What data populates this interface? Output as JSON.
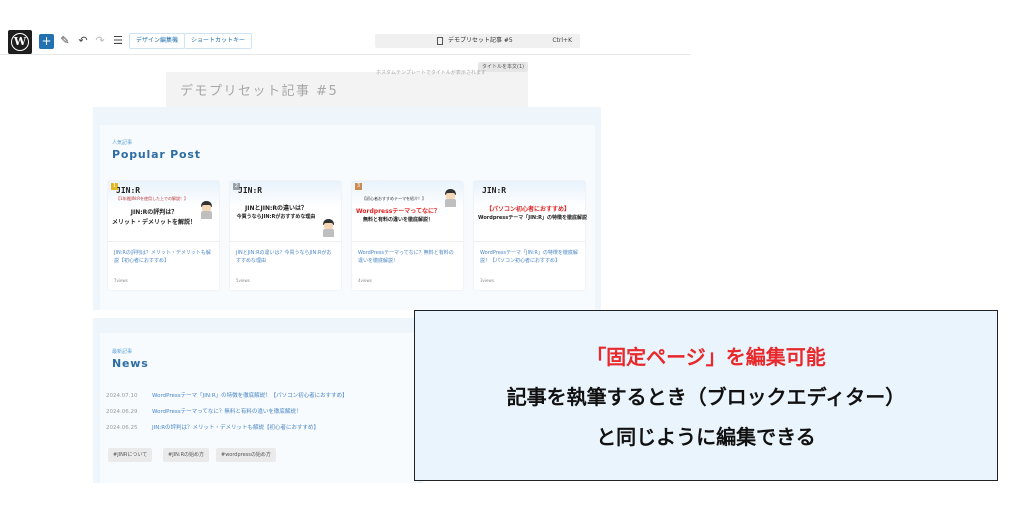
{
  "toolbar": {
    "design_edit_label": "デザイン編集機",
    "shortcut_label": "ショートカットキー",
    "document_title": "デモプリセット記事 #5",
    "shortcut_kbd": "Ctrl+K",
    "tooltip": "タイトルを本文(1)",
    "hint": "ホスタムテンプレートでタイトルが表示されます"
  },
  "editor": {
    "page_title": "デモプリセット記事 #5"
  },
  "popular": {
    "sub": "人気記事",
    "heading": "Popular Post",
    "cards": [
      {
        "rank": "1",
        "logo": "JIN:R",
        "caption": "【1年間JIN:Rを使用した上での解説！】",
        "line1": "JIN:Rの評判は？",
        "line2": "メリット・デメリットを解説！",
        "text": "JIN:Rの評判は？メリット・デメリットも解説【初心者におすすめ】",
        "date": "7views"
      },
      {
        "rank": "2",
        "logo": "JIN:R",
        "caption": "",
        "line1": "JINとJIN:Rの違いは？",
        "line2": "今買うならJIN:Rがおすすめな理由",
        "text": "JINとJIN:Rの違いは？今買うならJIN:Rがおすすめな理由",
        "date": "5views"
      },
      {
        "rank": "3",
        "logo": "",
        "caption": "【初心者おすすめテーマを紹介！】",
        "line1": "Wordpressテーマってなに？",
        "line2": "無料と有料の違いを徹底解説！",
        "text": "WordPressテーマってなに？無料と有料の違いを徹底解説！",
        "date": "4views"
      },
      {
        "rank": "",
        "logo": "JIN:R",
        "caption": "",
        "line1": "【パソコン初心者におすすめ】",
        "line2": "Wordpressテーマ「JIN:R」の特徴を徹底解説",
        "text": "WordPressテーマ「JIN:R」の特徴を徹底解説！【パソコン初心者におすすめ】",
        "date": "3views"
      }
    ]
  },
  "news": {
    "sub": "最新記事",
    "heading": "News",
    "items": [
      {
        "date": "2024.07.10",
        "title": "WordPressテーマ「JIN:R」の特徴を徹底解説！【パソコン初心者におすすめ】"
      },
      {
        "date": "2024.06.29",
        "title": "WordPressテーマってなに？無料と有料の違いを徹底解説！"
      },
      {
        "date": "2024.06.25",
        "title": "JIN:Rの評判は？メリット・デメリットも解説【初心者におすすめ】"
      }
    ],
    "tags": [
      "#JINRについて",
      "#JIN:Rの始め方",
      "#wordpressの始め方"
    ]
  },
  "callout": {
    "line1": "「固定ページ」を編集可能",
    "line2": "記事を執筆するとき（ブロックエディター）",
    "line3": "と同じように編集できる"
  },
  "colors": {
    "accent": "#2271b1",
    "heading_blue": "#2e6da4",
    "link_blue": "#4a86c5",
    "callout_red": "#e8282a",
    "section_bg": "#eef6fc"
  }
}
